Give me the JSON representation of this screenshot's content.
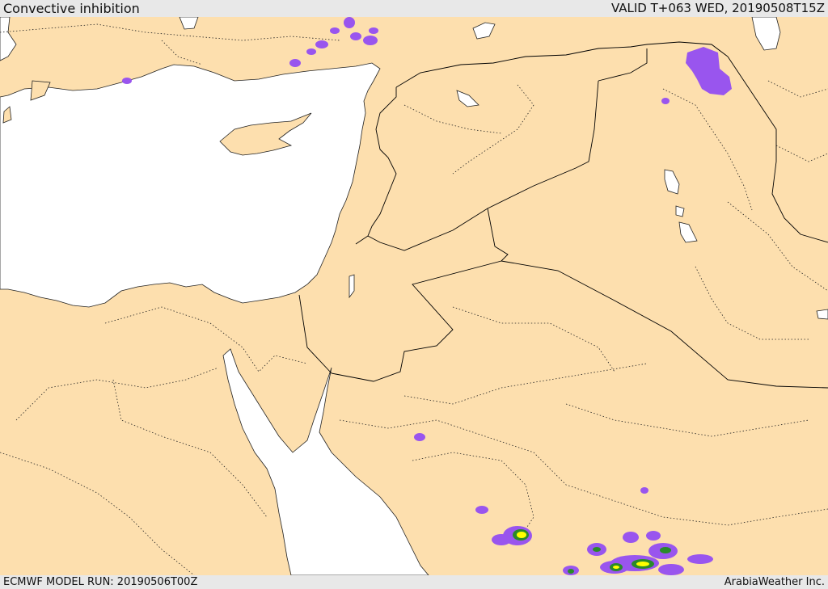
{
  "header": {
    "title": "Convective inhibition",
    "valid": "VALID T+063 WED, 20190508T15Z"
  },
  "footer": {
    "model_run": "ECMWF MODEL RUN: 20190506T00Z",
    "credit": "ArabiaWeather Inc."
  },
  "colors": {
    "land": "#fddfae",
    "sea": "#ffffff",
    "border": "#000000",
    "cin_low": "#9955ee",
    "cin_mid": "#2a8a2a",
    "cin_high": "#ffff00"
  }
}
